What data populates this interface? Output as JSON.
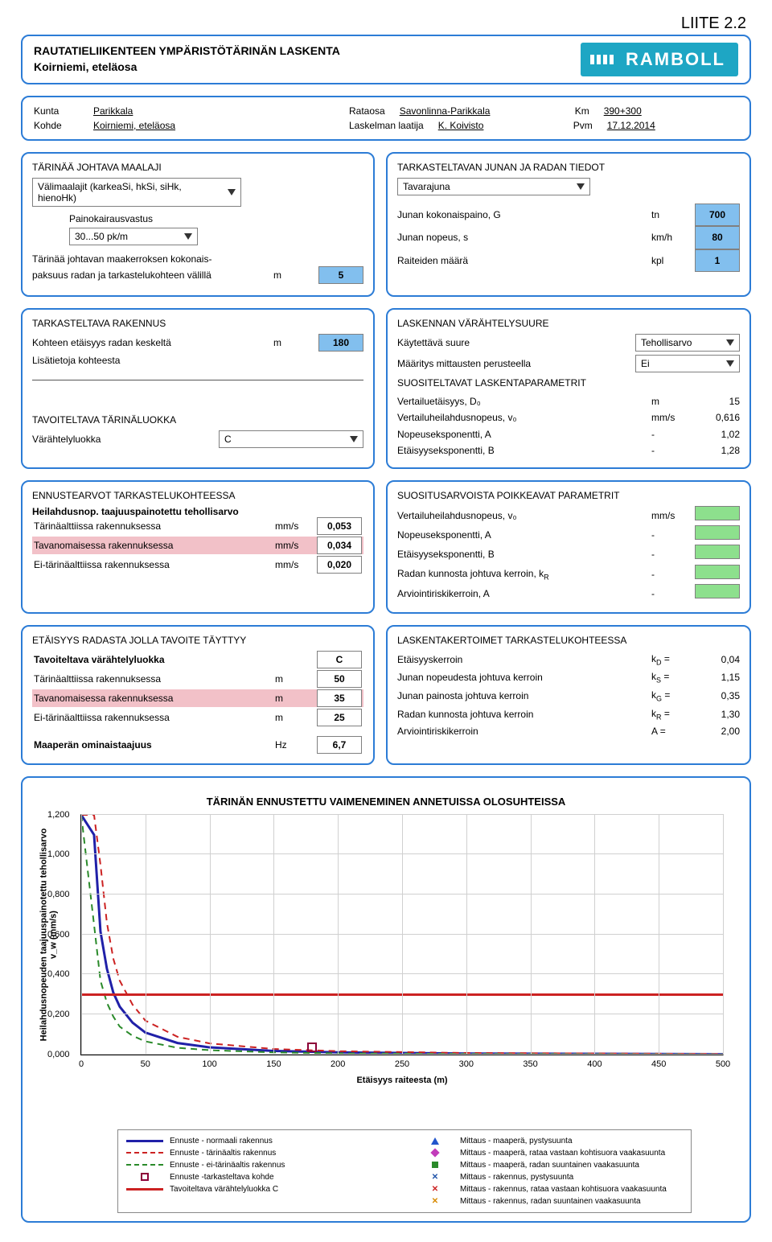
{
  "liite": "LIITE 2.2",
  "title1": "RAUTATIELIIKENTEEN YMPÄRISTÖTÄRINÄN LASKENTA",
  "title2": "Koirniemi, eteläosa",
  "logo_text": "RAMBOLL",
  "meta": {
    "kunta_lbl": "Kunta",
    "kunta_val": "Parikkala",
    "kohde_lbl": "Kohde",
    "kohde_val": "Koirniemi, eteläosa",
    "rataosa_lbl": "Rataosa",
    "rataosa_val": "Savonlinna-Parikkala",
    "laskija_lbl": "Laskelman laatija",
    "laskija_val": "K. Koivisto",
    "km_lbl": "Km",
    "km_val": "390+300",
    "pvm_lbl": "Pvm",
    "pvm_val": "17.12.2014"
  },
  "soil": {
    "title": "TÄRINÄÄ JOHTAVA MAALAJI",
    "valimaalajit": "Välimaalajit (karkeaSi, hkSi, siHk, hienoHk)",
    "painokairausvastus_lbl": "Painokairausvastus",
    "pk_value": "30...50 pk/m",
    "thickness_lbl": "Tärinää johtavan maakerroksen kokonais-",
    "thickness_lbl2": "paksuus radan ja tarkastelukohteen välillä",
    "thickness_unit": "m",
    "thickness_val": "5"
  },
  "train": {
    "title": "TARKASTELTAVAN JUNAN JA RADAN TIEDOT",
    "type": "Tavarajuna",
    "paino_lbl": "Junan kokonaispaino, G",
    "paino_unit": "tn",
    "paino_val": "700",
    "nopeus_lbl": "Junan nopeus, s",
    "nopeus_unit": "km/h",
    "nopeus_val": "80",
    "raiteet_lbl": "Raiteiden määrä",
    "raiteet_unit": "kpl",
    "raiteet_val": "1"
  },
  "kohde": {
    "title": "TARKASTELTAVA RAKENNUS",
    "dist_lbl": "Kohteen etäisyys radan keskeltä",
    "dist_unit": "m",
    "dist_val": "180",
    "info_lbl": "Lisätietoja kohteesta"
  },
  "tavoite": {
    "title": "TAVOITELTAVA TÄRINÄLUOKKA",
    "luokka_lbl": "Värähtelyluokka",
    "luokka_val": "C"
  },
  "laskenta": {
    "title": "LASKENNAN VÄRÄHTELYSUURE",
    "suure_lbl": "Käytettävä suure",
    "suure_val": "Tehollisarvo",
    "maaritys_lbl": "Määritys mittausten perusteella",
    "maaritys_val": "Ei",
    "suositus_title": "SUOSITELTAVAT LASKENTAPARAMETRIT",
    "d0_lbl": "Vertailuetäisyys, D₀",
    "d0_unit": "m",
    "d0_val": "15",
    "v0_lbl": "Vertailuheilahdusnopeus, v₀",
    "v0_unit": "mm/s",
    "v0_val": "0,616",
    "a_lbl": "Nopeuseksponentti, A",
    "a_unit": "-",
    "a_val": "1,02",
    "b_lbl": "Etäisyyseksponentti, B",
    "b_unit": "-",
    "b_val": "1,28"
  },
  "ennuste": {
    "title": "ENNUSTEARVOT TARKASTELUKOHTEESSA",
    "subtitle": "Heilahdusnop. taajuuspainotettu tehollisarvo",
    "r1_lbl": "Tärinäalttiissa rakennuksessa",
    "r1_u": "mm/s",
    "r1_v": "0,053",
    "r2_lbl": "Tavanomaisessa rakennuksessa",
    "r2_u": "mm/s",
    "r2_v": "0,034",
    "r3_lbl": "Ei-tärinäalttiissa rakennuksessa",
    "r3_u": "mm/s",
    "r3_v": "0,020"
  },
  "poikkeavat": {
    "title": "SUOSITUSARVOISTA POIKKEAVAT PARAMETRIT",
    "v0_lbl": "Vertailuheilahdusnopeus, v₀",
    "v0_unit": "mm/s",
    "a_lbl": "Nopeuseksponentti, A",
    "a_unit": "-",
    "b_lbl": "Etäisyyseksponentti, B",
    "b_unit": "-",
    "kr_lbl": "Radan kunnosta johtuva kerroin, k",
    "kr_sub": "R",
    "kr_unit": "-",
    "ar_lbl": "Arviointiriskikerroin, A",
    "ar_unit": "-"
  },
  "etaisyys": {
    "title": "ETÄISYYS RADASTA JOLLA TAVOITE TÄYTTYY",
    "luokka_lbl": "Tavoiteltava värähtelyluokka",
    "luokka_val": "C",
    "r1_lbl": "Tärinäalttiissa rakennuksessa",
    "r1_u": "m",
    "r1_v": "50",
    "r2_lbl": "Tavanomaisessa rakennuksessa",
    "r2_u": "m",
    "r2_v": "35",
    "r3_lbl": "Ei-tärinäalttiissa rakennuksessa",
    "r3_u": "m",
    "r3_v": "25",
    "mp_lbl": "Maaperän ominaistaajuus",
    "mp_u": "Hz",
    "mp_v": "6,7"
  },
  "kertoimet": {
    "title": "LASKENTAKERTOIMET TARKASTELUKOHTEESSA",
    "r1_lbl": "Etäisyyskerroin",
    "r1_sym": "k",
    "r1_sub": "D",
    "r1_eq": "=",
    "r1_v": "0,04",
    "r2_lbl": "Junan nopeudesta johtuva kerroin",
    "r2_sym": "k",
    "r2_sub": "S",
    "r2_eq": "=",
    "r2_v": "1,15",
    "r3_lbl": "Junan painosta johtuva kerroin",
    "r3_sym": "k",
    "r3_sub": "G",
    "r3_eq": "=",
    "r3_v": "0,35",
    "r4_lbl": "Radan kunnosta johtuva kerroin",
    "r4_sym": "k",
    "r4_sub": "R",
    "r4_eq": "=",
    "r4_v": "1,30",
    "r5_lbl": "Arviointiriskikerroin",
    "r5_sym": "A",
    "r5_eq": "=",
    "r5_v": "2,00"
  },
  "chart_title": "TÄRINÄN ENNUSTETTU VAIMENEMINEN ANNETUISSA OLOSUHTEISSA",
  "chart": {
    "y_label": "Heilahdusnopeuden taajuuspainotettu tehollisarvo\nv_w (mm/s)",
    "x_label": "Etäisyys raiteesta (m)",
    "y_ticks": [
      "0,000",
      "0,200",
      "0,400",
      "0,600",
      "0,800",
      "1,000",
      "1,200"
    ],
    "x_ticks": [
      "0",
      "50",
      "100",
      "150",
      "200",
      "250",
      "300",
      "350",
      "400",
      "450",
      "500"
    ]
  },
  "legend": {
    "l1": "Ennuste - normaali rakennus",
    "l2": "Ennuste - tärinäaltis rakennus",
    "l3": "Ennuste - ei-tärinäaltis rakennus",
    "l4": "Ennuste -tarkasteltava kohde",
    "l5": "Tavoiteltava värähtelyluokka C",
    "r1": "Mittaus - maaperä, pystysuunta",
    "r2": "Mittaus - maaperä, rataa vastaan kohtisuora vaakasuunta",
    "r3": "Mittaus - maaperä, radan suuntainen vaakasuunta",
    "r4": "Mittaus - rakennus, pystysuunta",
    "r5": "Mittaus - rakennus, rataa vastaan kohtisuora vaakasuunta",
    "r6": "Mittaus - rakennus, radan suuntainen vaakasuunta"
  },
  "chart_data": {
    "type": "line",
    "xlabel": "Etäisyys raiteesta (m)",
    "ylabel": "Heilahdusnopeuden taajuuspainotettu tehollisarvo v_w (mm/s)",
    "xlim": [
      0,
      500
    ],
    "ylim": [
      0,
      1.2
    ],
    "x": [
      0,
      10,
      15,
      20,
      25,
      30,
      40,
      50,
      75,
      100,
      150,
      200,
      300,
      500
    ],
    "series": [
      {
        "name": "Ennuste - normaali rakennus",
        "values": [
          1.2,
          1.1,
          0.616,
          0.43,
          0.31,
          0.24,
          0.16,
          0.11,
          0.058,
          0.036,
          0.018,
          0.011,
          0.005,
          0.002
        ]
      },
      {
        "name": "Ennuste - tärinäaltis rakennus",
        "values": [
          1.2,
          1.2,
          0.95,
          0.66,
          0.48,
          0.37,
          0.25,
          0.17,
          0.089,
          0.056,
          0.028,
          0.017,
          0.008,
          0.003
        ]
      },
      {
        "name": "Ennuste - ei-tärinäaltis rakennus",
        "values": [
          1.2,
          0.65,
          0.37,
          0.26,
          0.19,
          0.14,
          0.094,
          0.066,
          0.034,
          0.022,
          0.011,
          0.006,
          0.003,
          0.001
        ]
      },
      {
        "name": "Tavoiteltava värähtelyluokka C",
        "values": [
          0.3,
          0.3,
          0.3,
          0.3,
          0.3,
          0.3,
          0.3,
          0.3,
          0.3,
          0.3,
          0.3,
          0.3,
          0.3,
          0.3
        ]
      }
    ],
    "target_point": {
      "name": "Ennuste - tarkasteltava kohde",
      "x": 180,
      "y": 0.034
    }
  }
}
